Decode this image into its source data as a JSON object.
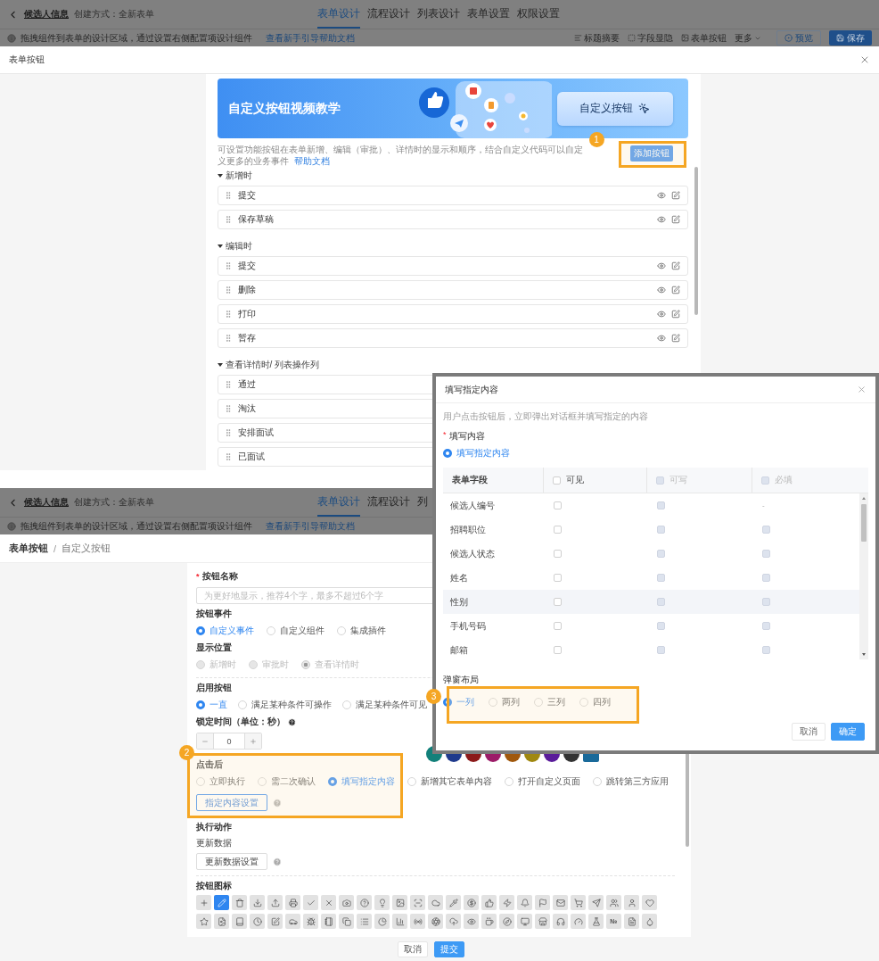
{
  "top": {
    "header": {
      "title": "候选人信息",
      "subtitle": "创建方式：全新表单",
      "tabs": [
        {
          "label": "表单设计",
          "selected": true
        },
        {
          "label": "流程设计",
          "selected": false
        },
        {
          "label": "列表设计",
          "selected": false
        },
        {
          "label": "表单设置",
          "selected": false
        },
        {
          "label": "权限设置",
          "selected": false
        }
      ],
      "tip": "拖拽组件到表单的设计区域，通过设置右侧配置项设计组件",
      "tip_link": "查看新手引导帮助文档",
      "tools": [
        "标题摘要",
        "字段显隐",
        "表单按钮"
      ],
      "more": "更多",
      "preview": "预览",
      "save": "保存"
    },
    "modal": {
      "title": "表单按钮",
      "banner": {
        "title": "自定义按钮视频教学",
        "card_label": "自定义按钮"
      },
      "help": "可设置功能按钮在表单新增、编辑（审批）、详情时的显示和顺序，结合自定义代码可以自定义更多的业务事件",
      "help_link": "帮助文档",
      "add_button": "添加按钮",
      "groups": [
        {
          "title": "新增时",
          "expanded": true,
          "items": [
            {
              "label": "提交",
              "actions": true
            },
            {
              "label": "保存草稿",
              "actions": true
            }
          ]
        },
        {
          "title": "编辑时",
          "expanded": true,
          "items": [
            {
              "label": "提交",
              "actions": true
            },
            {
              "label": "删除",
              "actions": true
            },
            {
              "label": "打印",
              "actions": true
            },
            {
              "label": "暂存",
              "actions": true
            }
          ]
        },
        {
          "title": "查看详情时/ 列表操作列",
          "expanded": true,
          "items": [
            {
              "label": "通过"
            },
            {
              "label": "淘汰"
            },
            {
              "label": "安排面试"
            },
            {
              "label": "已面试"
            }
          ]
        }
      ]
    }
  },
  "bottom": {
    "header": {
      "title": "候选人信息",
      "subtitle": "创建方式：全新表单",
      "tabs": [
        {
          "label": "表单设计",
          "selected": true
        },
        {
          "label": "流程设计",
          "selected": false
        },
        {
          "label": "列",
          "selected": false
        }
      ],
      "tip": "拖拽组件到表单的设计区域，通过设置右侧配置项设计组件",
      "tip_link": "查看新手引导帮助文档"
    },
    "breadcrumb": {
      "parent": "表单按钮",
      "separator": "/",
      "current": "自定义按钮"
    },
    "form": {
      "name": {
        "label": "按钮名称",
        "required_mark": "*",
        "placeholder": "为更好地显示，推荐4个字，最多不超过6个字"
      },
      "event": {
        "label": "按钮事件",
        "options": [
          {
            "label": "自定义事件",
            "selected": true
          },
          {
            "label": "自定义组件",
            "selected": false
          },
          {
            "label": "集成插件",
            "selected": false
          }
        ]
      },
      "position": {
        "label": "显示位置",
        "options": [
          {
            "label": "新增时",
            "selected": false,
            "disabled": true
          },
          {
            "label": "审批时",
            "selected": false,
            "disabled": true
          },
          {
            "label": "查看详情时",
            "selected": true,
            "disabled": true
          }
        ]
      },
      "enable": {
        "label": "启用按钮",
        "options": [
          {
            "label": "一直",
            "selected": true
          },
          {
            "label": "满足某种条件可操作",
            "selected": false
          },
          {
            "label": "满足某种条件可见",
            "selected": false
          }
        ]
      },
      "lock": {
        "label": "锁定时间（单位：秒）",
        "value": "0"
      },
      "swatches": [
        {
          "color": "#12807a"
        },
        {
          "color": "#1f3a8c"
        },
        {
          "color": "#8c1a1a"
        },
        {
          "color": "#9c1c68"
        },
        {
          "color": "#a0580c"
        },
        {
          "color": "#a08810"
        },
        {
          "color": "#5a1c9a"
        },
        {
          "color": "#333333"
        },
        {
          "color": "#1a6a9a"
        }
      ],
      "after_click": {
        "label": "点击后",
        "options": [
          {
            "label": "立即执行",
            "selected": false
          },
          {
            "label": "需二次确认",
            "selected": false
          },
          {
            "label": "填写指定内容",
            "selected": true
          },
          {
            "label": "新增其它表单内容",
            "selected": false
          },
          {
            "label": "打开自定义页面",
            "selected": false
          },
          {
            "label": "跳转第三方应用",
            "selected": false
          }
        ],
        "settings_button": "指定内容设置"
      },
      "action": {
        "label": "执行动作",
        "sublabel": "更新数据",
        "button": "更新数据设置"
      },
      "icons": {
        "label": "按钮图标",
        "rows": [
          [
            {
              "selected": false
            },
            {
              "selected": true
            },
            {
              "selected": false
            },
            {
              "selected": false
            },
            {
              "selected": false
            },
            {
              "selected": false
            },
            {
              "selected": false
            },
            {
              "selected": false
            },
            {
              "selected": false
            },
            {
              "selected": false
            },
            {
              "selected": false
            },
            {
              "selected": false
            },
            {
              "selected": false
            },
            {
              "selected": false
            },
            {
              "selected": false
            },
            {
              "selected": false
            },
            {
              "selected": false
            },
            {
              "selected": false
            },
            {
              "selected": false
            },
            {
              "selected": false
            },
            {
              "selected": false
            },
            {
              "selected": false
            },
            {
              "selected": false
            },
            {
              "selected": false
            },
            {
              "selected": false
            },
            {
              "selected": false
            }
          ],
          [
            {
              "selected": false
            },
            {
              "selected": false
            },
            {
              "selected": false
            },
            {
              "selected": false
            },
            {
              "selected": false
            },
            {
              "selected": false
            },
            {
              "selected": false
            },
            {
              "selected": false
            },
            {
              "selected": false
            },
            {
              "selected": false
            },
            {
              "selected": false
            },
            {
              "selected": false
            },
            {
              "selected": false
            },
            {
              "selected": false
            },
            {
              "selected": false
            },
            {
              "selected": false
            },
            {
              "selected": false
            },
            {
              "selected": false
            },
            {
              "selected": false
            },
            {
              "selected": false
            },
            {
              "selected": false
            },
            {
              "selected": false
            },
            {
              "selected": false
            },
            {
              "selected": false,
              "glyph": "№"
            },
            {
              "selected": false
            },
            {
              "selected": false
            }
          ]
        ]
      }
    },
    "footer": {
      "cancel": "取消",
      "submit": "提交"
    }
  },
  "dialog": {
    "title": "填写指定内容",
    "description": "用户点击按钮后，立即弹出对话框并填写指定的内容",
    "content_label": "填写内容",
    "required_mark": "*",
    "content_option": {
      "label": "填写指定内容",
      "selected": true
    },
    "table": {
      "columns": [
        {
          "label": "表单字段",
          "kind": "text"
        },
        {
          "label": "可见",
          "kind": "checkbox",
          "checked": false,
          "disabled": false
        },
        {
          "label": "可写",
          "kind": "checkbox",
          "checked": false,
          "disabled": true
        },
        {
          "label": "必填",
          "kind": "checkbox",
          "checked": false,
          "disabled": true
        }
      ],
      "rows": [
        {
          "field": "候选人编号",
          "highlighted": false,
          "cells": [
            {
              "kind": "checkbox",
              "checked": false,
              "disabled": false
            },
            {
              "kind": "checkbox",
              "checked": false,
              "disabled": true
            },
            {
              "kind": "text",
              "text": "-"
            }
          ]
        },
        {
          "field": "招聘职位",
          "highlighted": false,
          "cells": [
            {
              "kind": "checkbox",
              "checked": false,
              "disabled": false
            },
            {
              "kind": "checkbox",
              "checked": false,
              "disabled": true
            },
            {
              "kind": "checkbox",
              "checked": false,
              "disabled": true
            }
          ]
        },
        {
          "field": "候选人状态",
          "highlighted": false,
          "cells": [
            {
              "kind": "checkbox",
              "checked": false,
              "disabled": false
            },
            {
              "kind": "checkbox",
              "checked": false,
              "disabled": true
            },
            {
              "kind": "checkbox",
              "checked": false,
              "disabled": true
            }
          ]
        },
        {
          "field": "姓名",
          "highlighted": false,
          "cells": [
            {
              "kind": "checkbox",
              "checked": false,
              "disabled": false
            },
            {
              "kind": "checkbox",
              "checked": false,
              "disabled": true
            },
            {
              "kind": "checkbox",
              "checked": false,
              "disabled": true
            }
          ]
        },
        {
          "field": "性别",
          "highlighted": true,
          "cells": [
            {
              "kind": "checkbox",
              "checked": false,
              "disabled": false
            },
            {
              "kind": "checkbox",
              "checked": false,
              "disabled": true
            },
            {
              "kind": "checkbox",
              "checked": false,
              "disabled": true
            }
          ]
        },
        {
          "field": "手机号码",
          "highlighted": false,
          "cells": [
            {
              "kind": "checkbox",
              "checked": false,
              "disabled": false
            },
            {
              "kind": "checkbox",
              "checked": false,
              "disabled": true
            },
            {
              "kind": "checkbox",
              "checked": false,
              "disabled": true
            }
          ]
        },
        {
          "field": "邮箱",
          "highlighted": false,
          "cells": [
            {
              "kind": "checkbox",
              "checked": false,
              "disabled": false
            },
            {
              "kind": "checkbox",
              "checked": false,
              "disabled": true
            },
            {
              "kind": "checkbox",
              "checked": false,
              "disabled": true
            }
          ]
        }
      ]
    },
    "layout": {
      "label": "弹窗布局",
      "options": [
        {
          "label": "一列",
          "selected": true
        },
        {
          "label": "两列",
          "selected": false
        },
        {
          "label": "三列",
          "selected": false
        },
        {
          "label": "四列",
          "selected": false
        }
      ]
    },
    "cancel": "取消",
    "confirm": "确定"
  },
  "annotations": [
    {
      "number": "1"
    },
    {
      "number": "2"
    },
    {
      "number": "3"
    }
  ]
}
